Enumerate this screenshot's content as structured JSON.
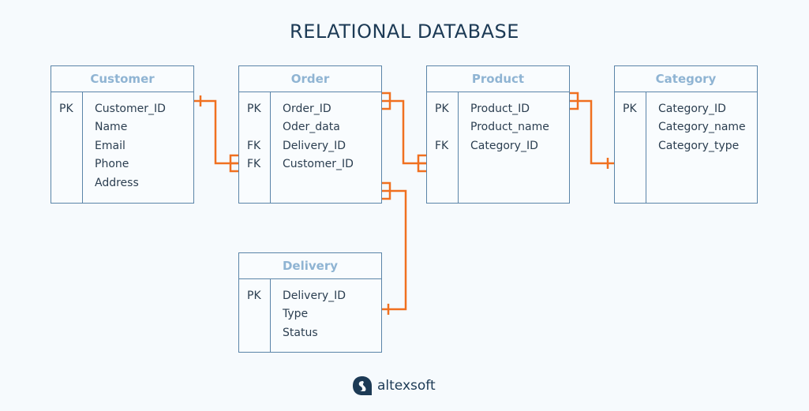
{
  "title": "RELATIONAL DATABASE",
  "colors": {
    "title": "#1c3a55",
    "entity_border": "#5a84a8",
    "entity_header_text": "#8fb4d3",
    "field_text": "#2b3e50",
    "relationship_line": "#f07020",
    "background": "#f6fafd"
  },
  "entities": {
    "customer": {
      "name": "Customer",
      "rows": [
        {
          "key": "PK",
          "field": "Customer_ID"
        },
        {
          "key": "",
          "field": "Name"
        },
        {
          "key": "",
          "field": "Email"
        },
        {
          "key": "",
          "field": "Phone"
        },
        {
          "key": "",
          "field": "Address"
        }
      ]
    },
    "order": {
      "name": "Order",
      "rows": [
        {
          "key": "PK",
          "field": "Order_ID"
        },
        {
          "key": "",
          "field": "Oder_data"
        },
        {
          "key": "FK",
          "field": "Delivery_ID"
        },
        {
          "key": "FK",
          "field": "Customer_ID"
        }
      ]
    },
    "product": {
      "name": "Product",
      "rows": [
        {
          "key": "PK",
          "field": "Product_ID"
        },
        {
          "key": "",
          "field": "Product_name"
        },
        {
          "key": "FK",
          "field": "Category_ID"
        }
      ]
    },
    "category": {
      "name": "Category",
      "rows": [
        {
          "key": "PK",
          "field": "Category_ID"
        },
        {
          "key": "",
          "field": "Category_name"
        },
        {
          "key": "",
          "field": "Category_type"
        }
      ]
    },
    "delivery": {
      "name": "Delivery",
      "rows": [
        {
          "key": "PK",
          "field": "Delivery_ID"
        },
        {
          "key": "",
          "field": "Type"
        },
        {
          "key": "",
          "field": "Status"
        }
      ]
    }
  },
  "relationships": [
    {
      "from": "Customer.Customer_ID",
      "from_card": "one",
      "to": "Order.Customer_ID",
      "to_card": "many"
    },
    {
      "from": "Order.Order_ID",
      "from_card": "many",
      "to": "Product.Category_ID",
      "to_card": "many"
    },
    {
      "from": "Product.Product_ID",
      "from_card": "many",
      "to": "Category.Category_ID",
      "to_card": "one"
    },
    {
      "from": "Order",
      "from_card": "many",
      "to": "Delivery.Delivery_ID",
      "to_card": "one"
    }
  ],
  "logo": {
    "text": "altexsoft"
  }
}
